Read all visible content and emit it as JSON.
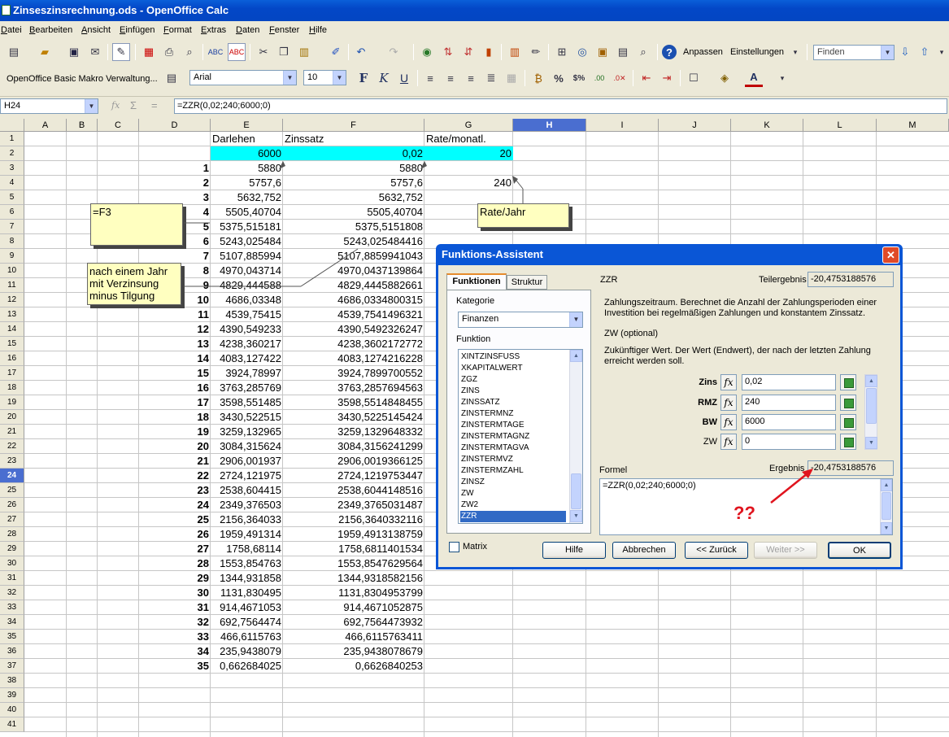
{
  "window": {
    "title": "Zinseszinsrechnung.ods - OpenOffice Calc"
  },
  "menu": [
    "Datei",
    "Bearbeiten",
    "Ansicht",
    "Einfügen",
    "Format",
    "Extras",
    "Daten",
    "Fenster",
    "Hilfe"
  ],
  "toolbar": {
    "customize_label": "Anpassen",
    "settings_label": "Einstellungen",
    "find_placeholder": "Finden"
  },
  "format_toolbar": {
    "macro_label": "OpenOffice Basic Makro Verwaltung...",
    "font_name": "Arial",
    "font_size": "10"
  },
  "formula_bar": {
    "cell_ref": "H24",
    "formula": "=ZZR(0,02;240;6000;0)"
  },
  "sheet": {
    "columns": [
      "A",
      "B",
      "C",
      "D",
      "E",
      "F",
      "G",
      "H",
      "I",
      "J",
      "K",
      "L",
      "M"
    ],
    "rows": [
      "1",
      "2",
      "3",
      "4",
      "5",
      "6",
      "7",
      "8",
      "9",
      "10",
      "11",
      "12",
      "13",
      "14",
      "15",
      "16",
      "17",
      "18",
      "19",
      "20",
      "21",
      "22",
      "23",
      "24",
      "25",
      "26",
      "27",
      "28",
      "29",
      "30",
      "31",
      "32",
      "33",
      "34",
      "35",
      "36",
      "37",
      "38",
      "39",
      "40",
      "41"
    ],
    "headers": {
      "e1": "Darlehen",
      "f1": "Zinssatz",
      "g1": "Rate/monatl."
    },
    "row2": {
      "e2": "6000",
      "f2": "0,02",
      "g2": "20"
    },
    "g4": "240",
    "d_col": [
      "1",
      "2",
      "3",
      "4",
      "5",
      "6",
      "7",
      "8",
      "9",
      "10",
      "11",
      "12",
      "13",
      "14",
      "15",
      "16",
      "17",
      "18",
      "19",
      "20",
      "21",
      "22",
      "23",
      "24",
      "25",
      "26",
      "27",
      "28",
      "29",
      "30",
      "31",
      "32",
      "33",
      "34",
      "35"
    ],
    "e_col": [
      "5880",
      "5757,6",
      "5632,752",
      "5505,40704",
      "5375,515181",
      "5243,025484",
      "5107,885994",
      "4970,043714",
      "4829,444588",
      "4686,03348",
      "4539,75415",
      "4390,549233",
      "4238,360217",
      "4083,127422",
      "3924,78997",
      "3763,285769",
      "3598,551485",
      "3430,522515",
      "3259,132965",
      "3084,315624",
      "2906,001937",
      "2724,121975",
      "2538,604415",
      "2349,376503",
      "2156,364033",
      "1959,491314",
      "1758,68114",
      "1553,854763",
      "1344,931858",
      "1131,830495",
      "914,4671053",
      "692,7564474",
      "466,6115763",
      "235,9438079",
      "0,662684025"
    ],
    "f_col": [
      "5880",
      "5757,6",
      "5632,752",
      "5505,40704",
      "5375,5151808",
      "5243,025484416",
      "5107,8859941043",
      "4970,0437139864",
      "4829,4445882661",
      "4686,0334800315",
      "4539,7541496321",
      "4390,5492326247",
      "4238,3602172772",
      "4083,1274216228",
      "3924,7899700552",
      "3763,2857694563",
      "3598,5514848455",
      "3430,5225145424",
      "3259,1329648332",
      "3084,3156241299",
      "2906,0019366125",
      "2724,1219753447",
      "2538,6044148516",
      "2349,3765031487",
      "2156,3640332116",
      "1959,4913138759",
      "1758,6811401534",
      "1553,8547629564",
      "1344,9318582156",
      "1131,8304953799",
      "914,4671052875",
      "692,7564473932",
      "466,6115763411",
      "235,9438078679",
      "0,6626840253"
    ]
  },
  "notes": {
    "note1": "=F3",
    "note2": "nach einem Jahr\nmit Verzinsung\nminus Tilgung",
    "note3": "Rate/Jahr"
  },
  "dialog": {
    "title": "Funktions-Assistent",
    "tabs": [
      "Funktionen",
      "Struktur"
    ],
    "category_label": "Kategorie",
    "category_value": "Finanzen",
    "function_label": "Funktion",
    "functions": [
      "XINTZINSFUSS",
      "XKAPITALWERT",
      "ZGZ",
      "ZINS",
      "ZINSSATZ",
      "ZINSTERMNZ",
      "ZINSTERMTAGE",
      "ZINSTERMTAGNZ",
      "ZINSTERMTAGVA",
      "ZINSTERMVZ",
      "ZINSTERMZAHL",
      "ZINSZ",
      "ZW",
      "ZW2",
      "ZZR"
    ],
    "selected_function": "ZZR",
    "func_name": "ZZR",
    "partial_label": "Teilergebnis",
    "partial_value": "-20,4753188576",
    "description": "Zahlungszeitraum. Berechnet die Anzahl der Zahlungsperioden einer Investition bei regelmäßigen Zahlungen und konstantem Zinssatz.",
    "param_title": "ZW (optional)",
    "param_desc": "Zukünftiger Wert. Der Wert (Endwert), der nach der letzten Zahlung erreicht werden soll.",
    "args": [
      {
        "label": "Zins",
        "value": "0,02"
      },
      {
        "label": "RMZ",
        "value": "240"
      },
      {
        "label": "BW",
        "value": "6000"
      },
      {
        "label": "ZW",
        "value": "0"
      }
    ],
    "formula_label": "Formel",
    "result_label": "Ergebnis",
    "result_value": "-20,4753188576",
    "formula_text": "=ZZR(0,02;240;6000;0)",
    "annotation": "??",
    "matrix_label": "Matrix",
    "buttons": {
      "help": "Hilfe",
      "cancel": "Abbrechen",
      "back": "<< Zurück",
      "next": "Weiter >>",
      "ok": "OK"
    }
  }
}
